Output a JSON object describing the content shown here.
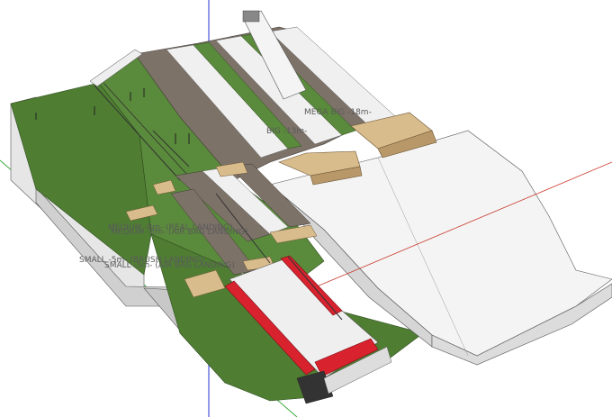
{
  "scene_labels": {
    "mega_big": "MEGA BIG -18m-",
    "big": "BIG -13m-",
    "medium_1": "MEDIUM -8m- (REAL LANDING)",
    "medium_2": "MEDIUM -8m- (AIR BAG LANDING)",
    "small_1": "SMALL -5m- (BRUSH LANDING)",
    "small_2": "SMALL -5m- (AIR BAG LANDING)"
  },
  "colors": {
    "grass": "#4f7e33",
    "grass_light": "#5f9040",
    "dirt": "#7d7268",
    "snow_white": "#f3f3f3",
    "side_gray": "#d8d8d8",
    "wood": "#d9bc8c",
    "airbag_red": "#d8232f",
    "axis_blue": "#2430d8",
    "axis_red": "#c83a2a",
    "axis_green": "#3aa83a"
  }
}
